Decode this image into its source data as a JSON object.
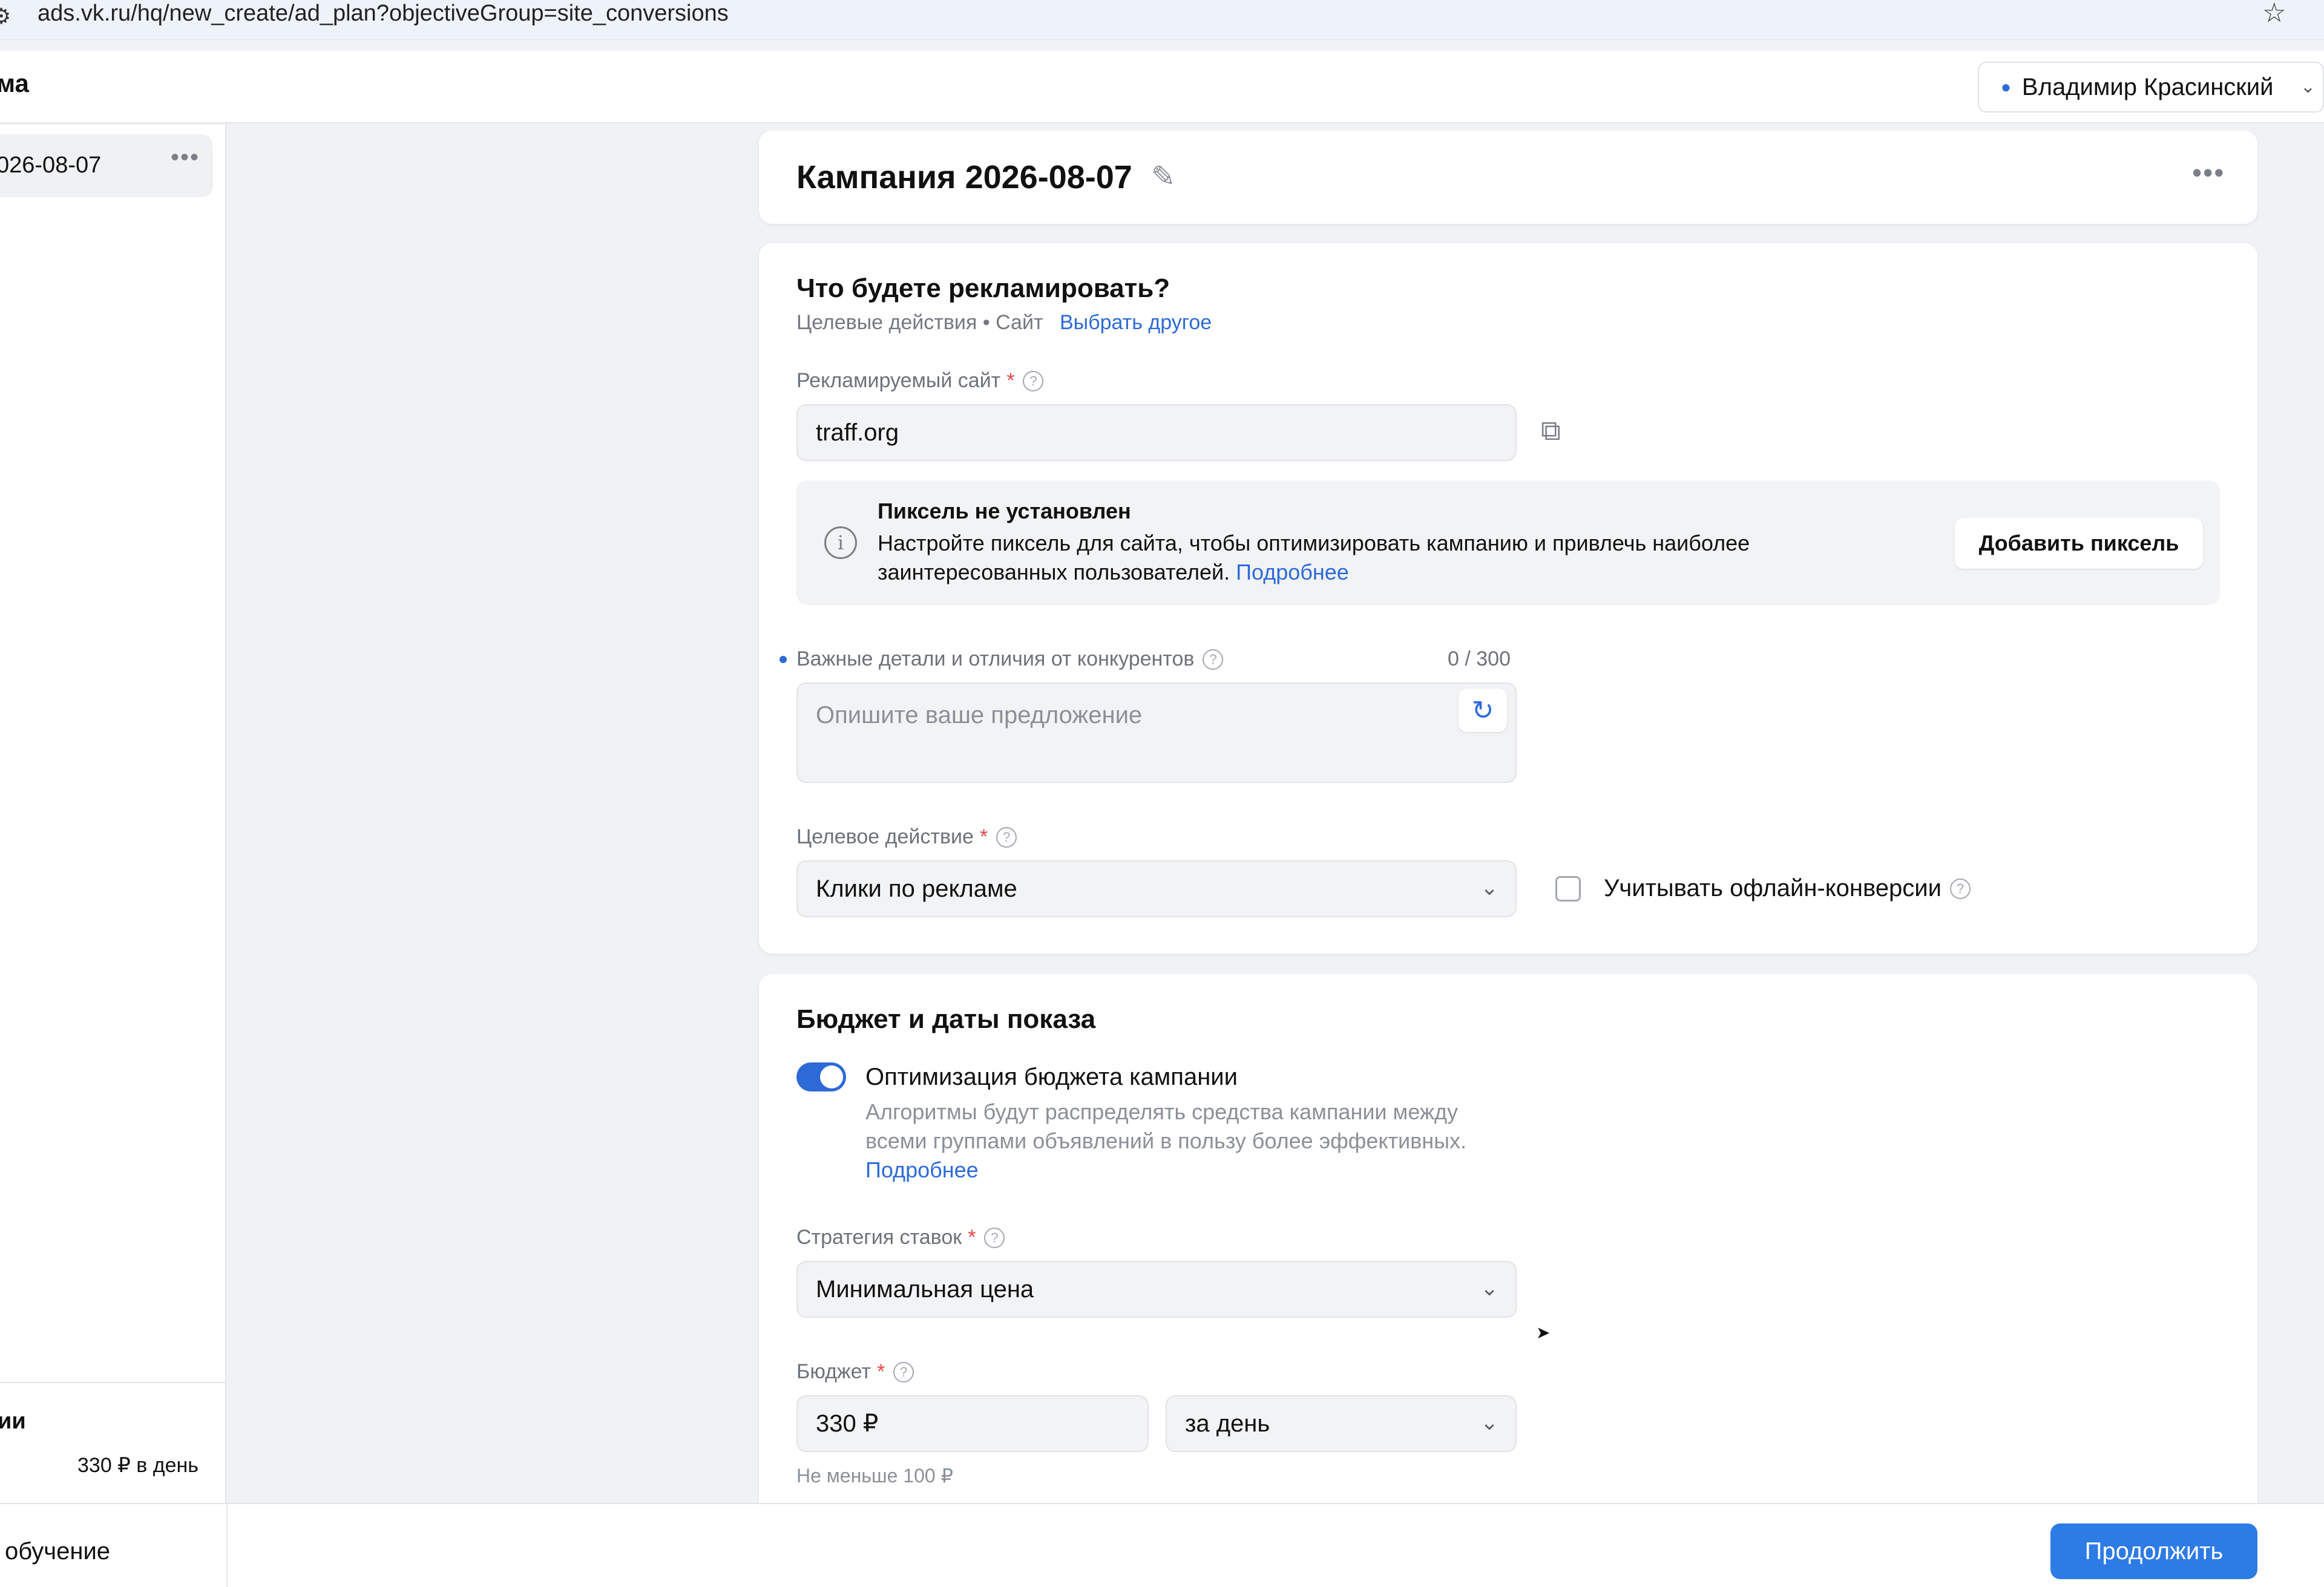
{
  "browser": {
    "url": "ads.vk.ru/hq/new_create/ad_plan?objectiveGroup=site_conversions"
  },
  "header": {
    "brand_fragment": "ма",
    "user_name": "Владимир Красинский"
  },
  "sidebar": {
    "campaign_item_label": "026-08-07",
    "summary_title": "ии",
    "summary_value": "330 ₽ в день"
  },
  "campaign": {
    "title": "Кампания 2026-08-07"
  },
  "what": {
    "heading": "Что будете рекламировать?",
    "objective_text": "Целевые действия • Сайт",
    "choose_other_link": "Выбрать другое",
    "site_label": "Рекламируемый сайт",
    "site_value": "traff.org",
    "pixel_title": "Пиксель не установлен",
    "pixel_desc": "Настройте пиксель для сайта, чтобы оптимизировать кампанию и привлечь наиболее заинтересованных пользователей.",
    "pixel_more_link": "Подробнее",
    "add_pixel_button": "Добавить пиксель",
    "details_label": "Важные детали и отличия от конкурентов",
    "details_counter": "0 / 300",
    "details_placeholder": "Опишите ваше предложение",
    "target_action_label": "Целевое действие",
    "target_action_value": "Клики по рекламе",
    "offline_conversions_label": "Учитывать офлайн-конверсии"
  },
  "budget": {
    "heading": "Бюджет и даты показа",
    "optimization_label": "Оптимизация бюджета кампании",
    "optimization_desc": "Алгоритмы будут распределять средства кампании между всеми группами объявлений в пользу более эффективных.",
    "optimization_more_link": "Подробнее",
    "optimization_enabled": true,
    "strategy_label": "Стратегия ставок",
    "strategy_value": "Минимальная цена",
    "budget_label": "Бюджет",
    "budget_value": "330 ₽",
    "period_value": "за день",
    "budget_hint": "Не меньше 100 ₽"
  },
  "footer": {
    "left_text": "обучение",
    "continue_button": "Продолжить"
  },
  "colors": {
    "accent": "#2d6ad8",
    "primary_button": "#2d7be5",
    "required": "#e64646"
  },
  "icons": {
    "pencil": "✎",
    "more": "•••",
    "external": "⧉",
    "info": "i",
    "refresh": "↻",
    "chevron": "⌄",
    "star": "☆",
    "cursor": "➤"
  }
}
